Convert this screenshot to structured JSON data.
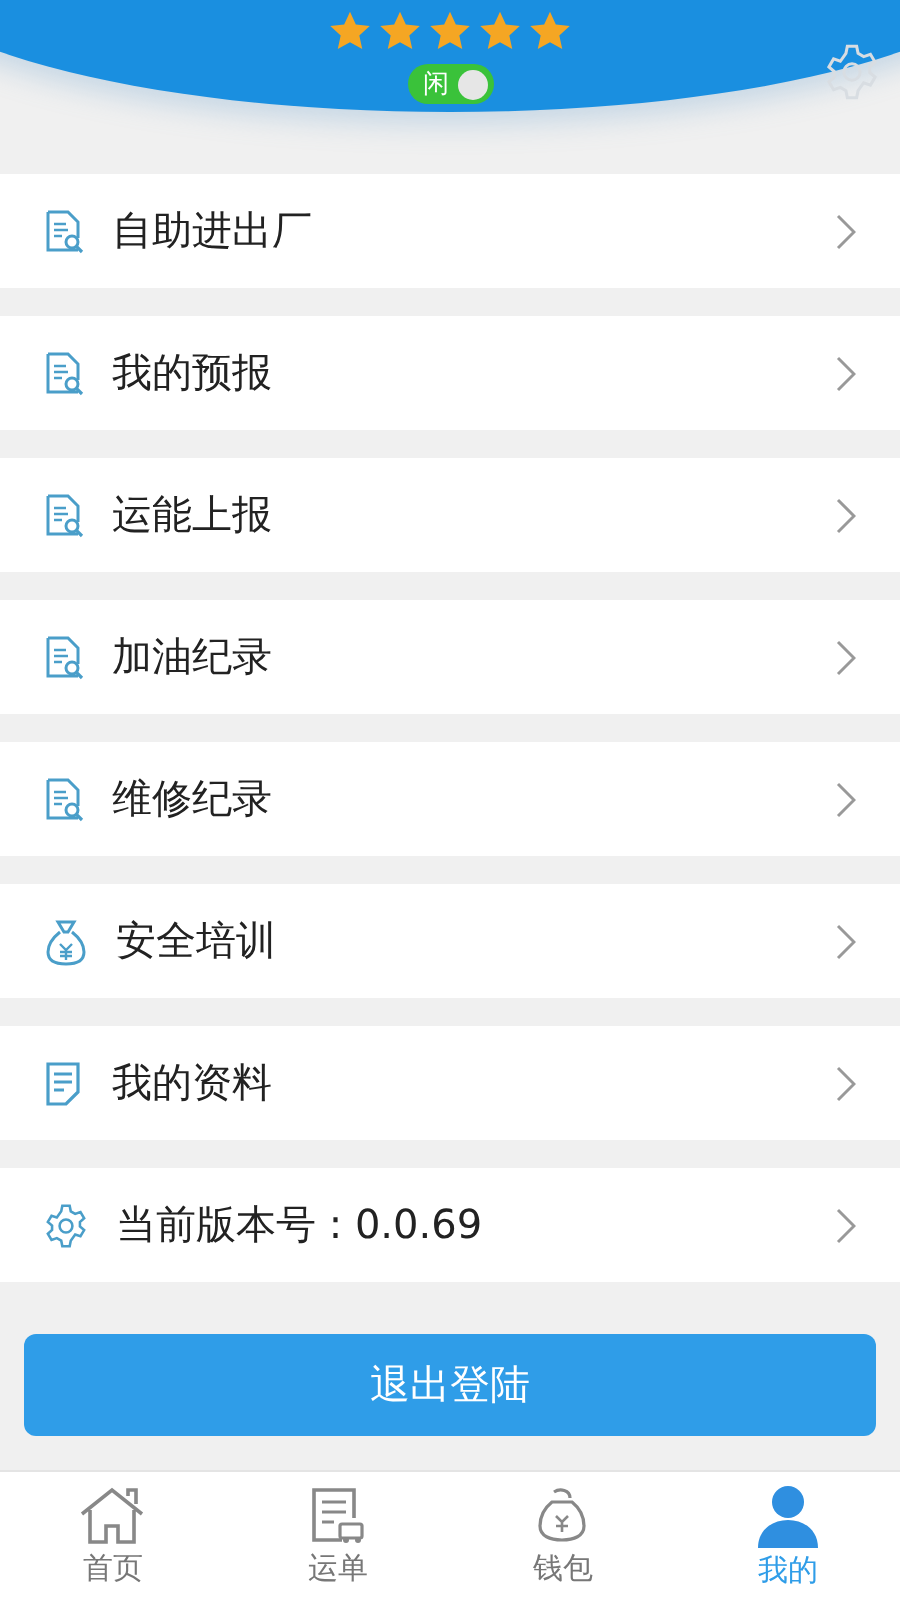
{
  "profile": {
    "stars": 5,
    "status": {
      "label": "闲",
      "on": true
    }
  },
  "menu": [
    {
      "kind": "report",
      "label": "自助进出厂"
    },
    {
      "kind": "report",
      "label": "我的预报"
    },
    {
      "kind": "report",
      "label": "运能上报"
    },
    {
      "kind": "report",
      "label": "加油纪录"
    },
    {
      "kind": "report",
      "label": "维修纪录"
    },
    {
      "kind": "bag",
      "label": "安全培训"
    },
    {
      "kind": "document",
      "label": "我的资料"
    },
    {
      "kind": "settings",
      "label": "当前版本号 : 0.0.69"
    }
  ],
  "logout_button": "退出登陆",
  "tab_bar": [
    {
      "kind": "home",
      "label": "首页",
      "selected": false
    },
    {
      "kind": "orders",
      "label": "运单",
      "selected": false
    },
    {
      "kind": "wallet",
      "label": "钱包",
      "selected": false
    },
    {
      "kind": "user",
      "label": "我的",
      "selected": true
    }
  ]
}
